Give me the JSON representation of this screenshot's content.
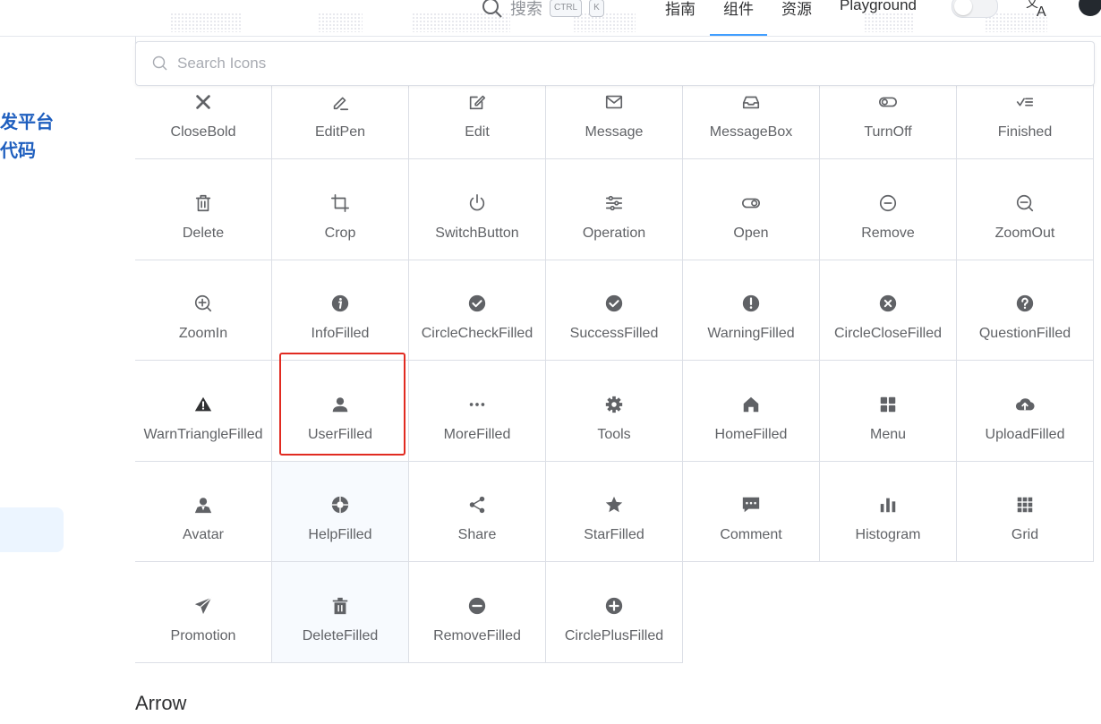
{
  "nav": {
    "search_label": "搜索",
    "kbd_ctrl": "CTRL",
    "kbd_k": "K",
    "links": [
      "指南",
      "组件",
      "资源",
      "Playground"
    ]
  },
  "sidebar": {
    "title_line1": "发平台",
    "title_line2": "代码"
  },
  "search": {
    "placeholder": "Search Icons"
  },
  "icons": [
    {
      "name": "CloseBold",
      "icon": "close-bold-icon"
    },
    {
      "name": "EditPen",
      "icon": "edit-pen-icon"
    },
    {
      "name": "Edit",
      "icon": "edit-icon"
    },
    {
      "name": "Message",
      "icon": "message-icon"
    },
    {
      "name": "MessageBox",
      "icon": "message-box-icon"
    },
    {
      "name": "TurnOff",
      "icon": "turn-off-icon"
    },
    {
      "name": "Finished",
      "icon": "finished-icon"
    },
    {
      "name": "Delete",
      "icon": "delete-icon"
    },
    {
      "name": "Crop",
      "icon": "crop-icon"
    },
    {
      "name": "SwitchButton",
      "icon": "switch-button-icon"
    },
    {
      "name": "Operation",
      "icon": "operation-icon"
    },
    {
      "name": "Open",
      "icon": "open-icon"
    },
    {
      "name": "Remove",
      "icon": "remove-icon"
    },
    {
      "name": "ZoomOut",
      "icon": "zoom-out-icon"
    },
    {
      "name": "ZoomIn",
      "icon": "zoom-in-icon"
    },
    {
      "name": "InfoFilled",
      "icon": "info-filled-icon"
    },
    {
      "name": "CircleCheckFilled",
      "icon": "circle-check-filled-icon"
    },
    {
      "name": "SuccessFilled",
      "icon": "success-filled-icon"
    },
    {
      "name": "WarningFilled",
      "icon": "warning-filled-icon"
    },
    {
      "name": "CircleCloseFilled",
      "icon": "circle-close-filled-icon"
    },
    {
      "name": "QuestionFilled",
      "icon": "question-filled-icon"
    },
    {
      "name": "WarnTriangleFilled",
      "icon": "warn-triangle-filled-icon"
    },
    {
      "name": "UserFilled",
      "icon": "user-filled-icon"
    },
    {
      "name": "MoreFilled",
      "icon": "more-filled-icon"
    },
    {
      "name": "Tools",
      "icon": "tools-icon"
    },
    {
      "name": "HomeFilled",
      "icon": "home-filled-icon"
    },
    {
      "name": "Menu",
      "icon": "menu-icon"
    },
    {
      "name": "UploadFilled",
      "icon": "upload-filled-icon"
    },
    {
      "name": "Avatar",
      "icon": "avatar-icon"
    },
    {
      "name": "HelpFilled",
      "icon": "help-filled-icon"
    },
    {
      "name": "Share",
      "icon": "share-icon"
    },
    {
      "name": "StarFilled",
      "icon": "star-filled-icon"
    },
    {
      "name": "Comment",
      "icon": "comment-icon"
    },
    {
      "name": "Histogram",
      "icon": "histogram-icon"
    },
    {
      "name": "Grid",
      "icon": "grid-icon"
    },
    {
      "name": "Promotion",
      "icon": "promotion-icon"
    },
    {
      "name": "DeleteFilled",
      "icon": "delete-filled-icon"
    },
    {
      "name": "RemoveFilled",
      "icon": "remove-filled-icon"
    },
    {
      "name": "CirclePlusFilled",
      "icon": "circle-plus-filled-icon"
    }
  ],
  "section": {
    "arrow_title": "Arrow"
  },
  "colors": {
    "accent": "#409eff",
    "selection": "#e12b21",
    "icon": "#606266"
  }
}
